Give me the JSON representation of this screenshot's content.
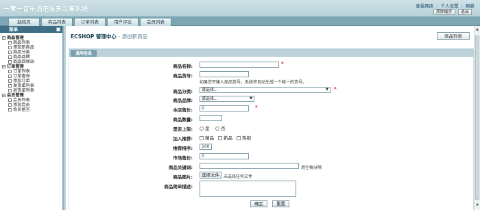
{
  "header": {
    "title": "一零一音乐酒吧股东众筹系统",
    "links": [
      "查看网店",
      "个人设置",
      "刷新"
    ],
    "buttons": [
      "清除缓存",
      "退出"
    ]
  },
  "nav": {
    "tabs": [
      "起始页",
      "商品列表",
      "订单列表",
      "用户评论",
      "会员列表"
    ]
  },
  "sidebar": {
    "title": "菜单",
    "groups": [
      {
        "label": "商品管理",
        "items": [
          "商品列表",
          "添加新商品",
          "商品分类",
          "商品品牌",
          "商品回收站"
        ]
      },
      {
        "label": "订单管理",
        "items": [
          "订单列表",
          "订单查询",
          "添加订单",
          "发货单列表",
          "退货单列表"
        ]
      },
      {
        "label": "会员管理",
        "items": [
          "会员列表",
          "添加会员",
          "会员留言"
        ]
      }
    ]
  },
  "main": {
    "title": "ECSHOP 管理中心",
    "subtitle": "- 添加新商品",
    "list_button": "商品列表",
    "tab_general": "通用信息",
    "form": {
      "name_label": "商品名称:",
      "sn_label": "商品货号:",
      "sn_hint": "如果您不输入商品货号，系统将自动生成一个唯一的货号。",
      "category_label": "商品分类:",
      "category_value": "请选择...",
      "brand_label": "商品品牌:",
      "brand_value": "请选择...",
      "shop_price_label": "本店售价:",
      "shop_price_value": "0",
      "number_label": "商品数量:",
      "on_sale_label": "是否上架:",
      "on_sale_yes": "是",
      "on_sale_no": "否",
      "recommend_label": "加入推荐:",
      "rec_best": "精品",
      "rec_new": "新品",
      "rec_hot": "热销",
      "sort_label": "推荐排序:",
      "sort_value": "100",
      "market_price_label": "市场售价:",
      "market_price_value": "0",
      "keywords_label": "商品关键词:",
      "keywords_hint": "用空格分隔",
      "image_label": "商品图片:",
      "file_button": "选择文件",
      "file_none": "未选择任何文件",
      "brief_label": "商品简单描述:",
      "required_mark": "*",
      "submit": "确定",
      "reset": "重置"
    }
  }
}
